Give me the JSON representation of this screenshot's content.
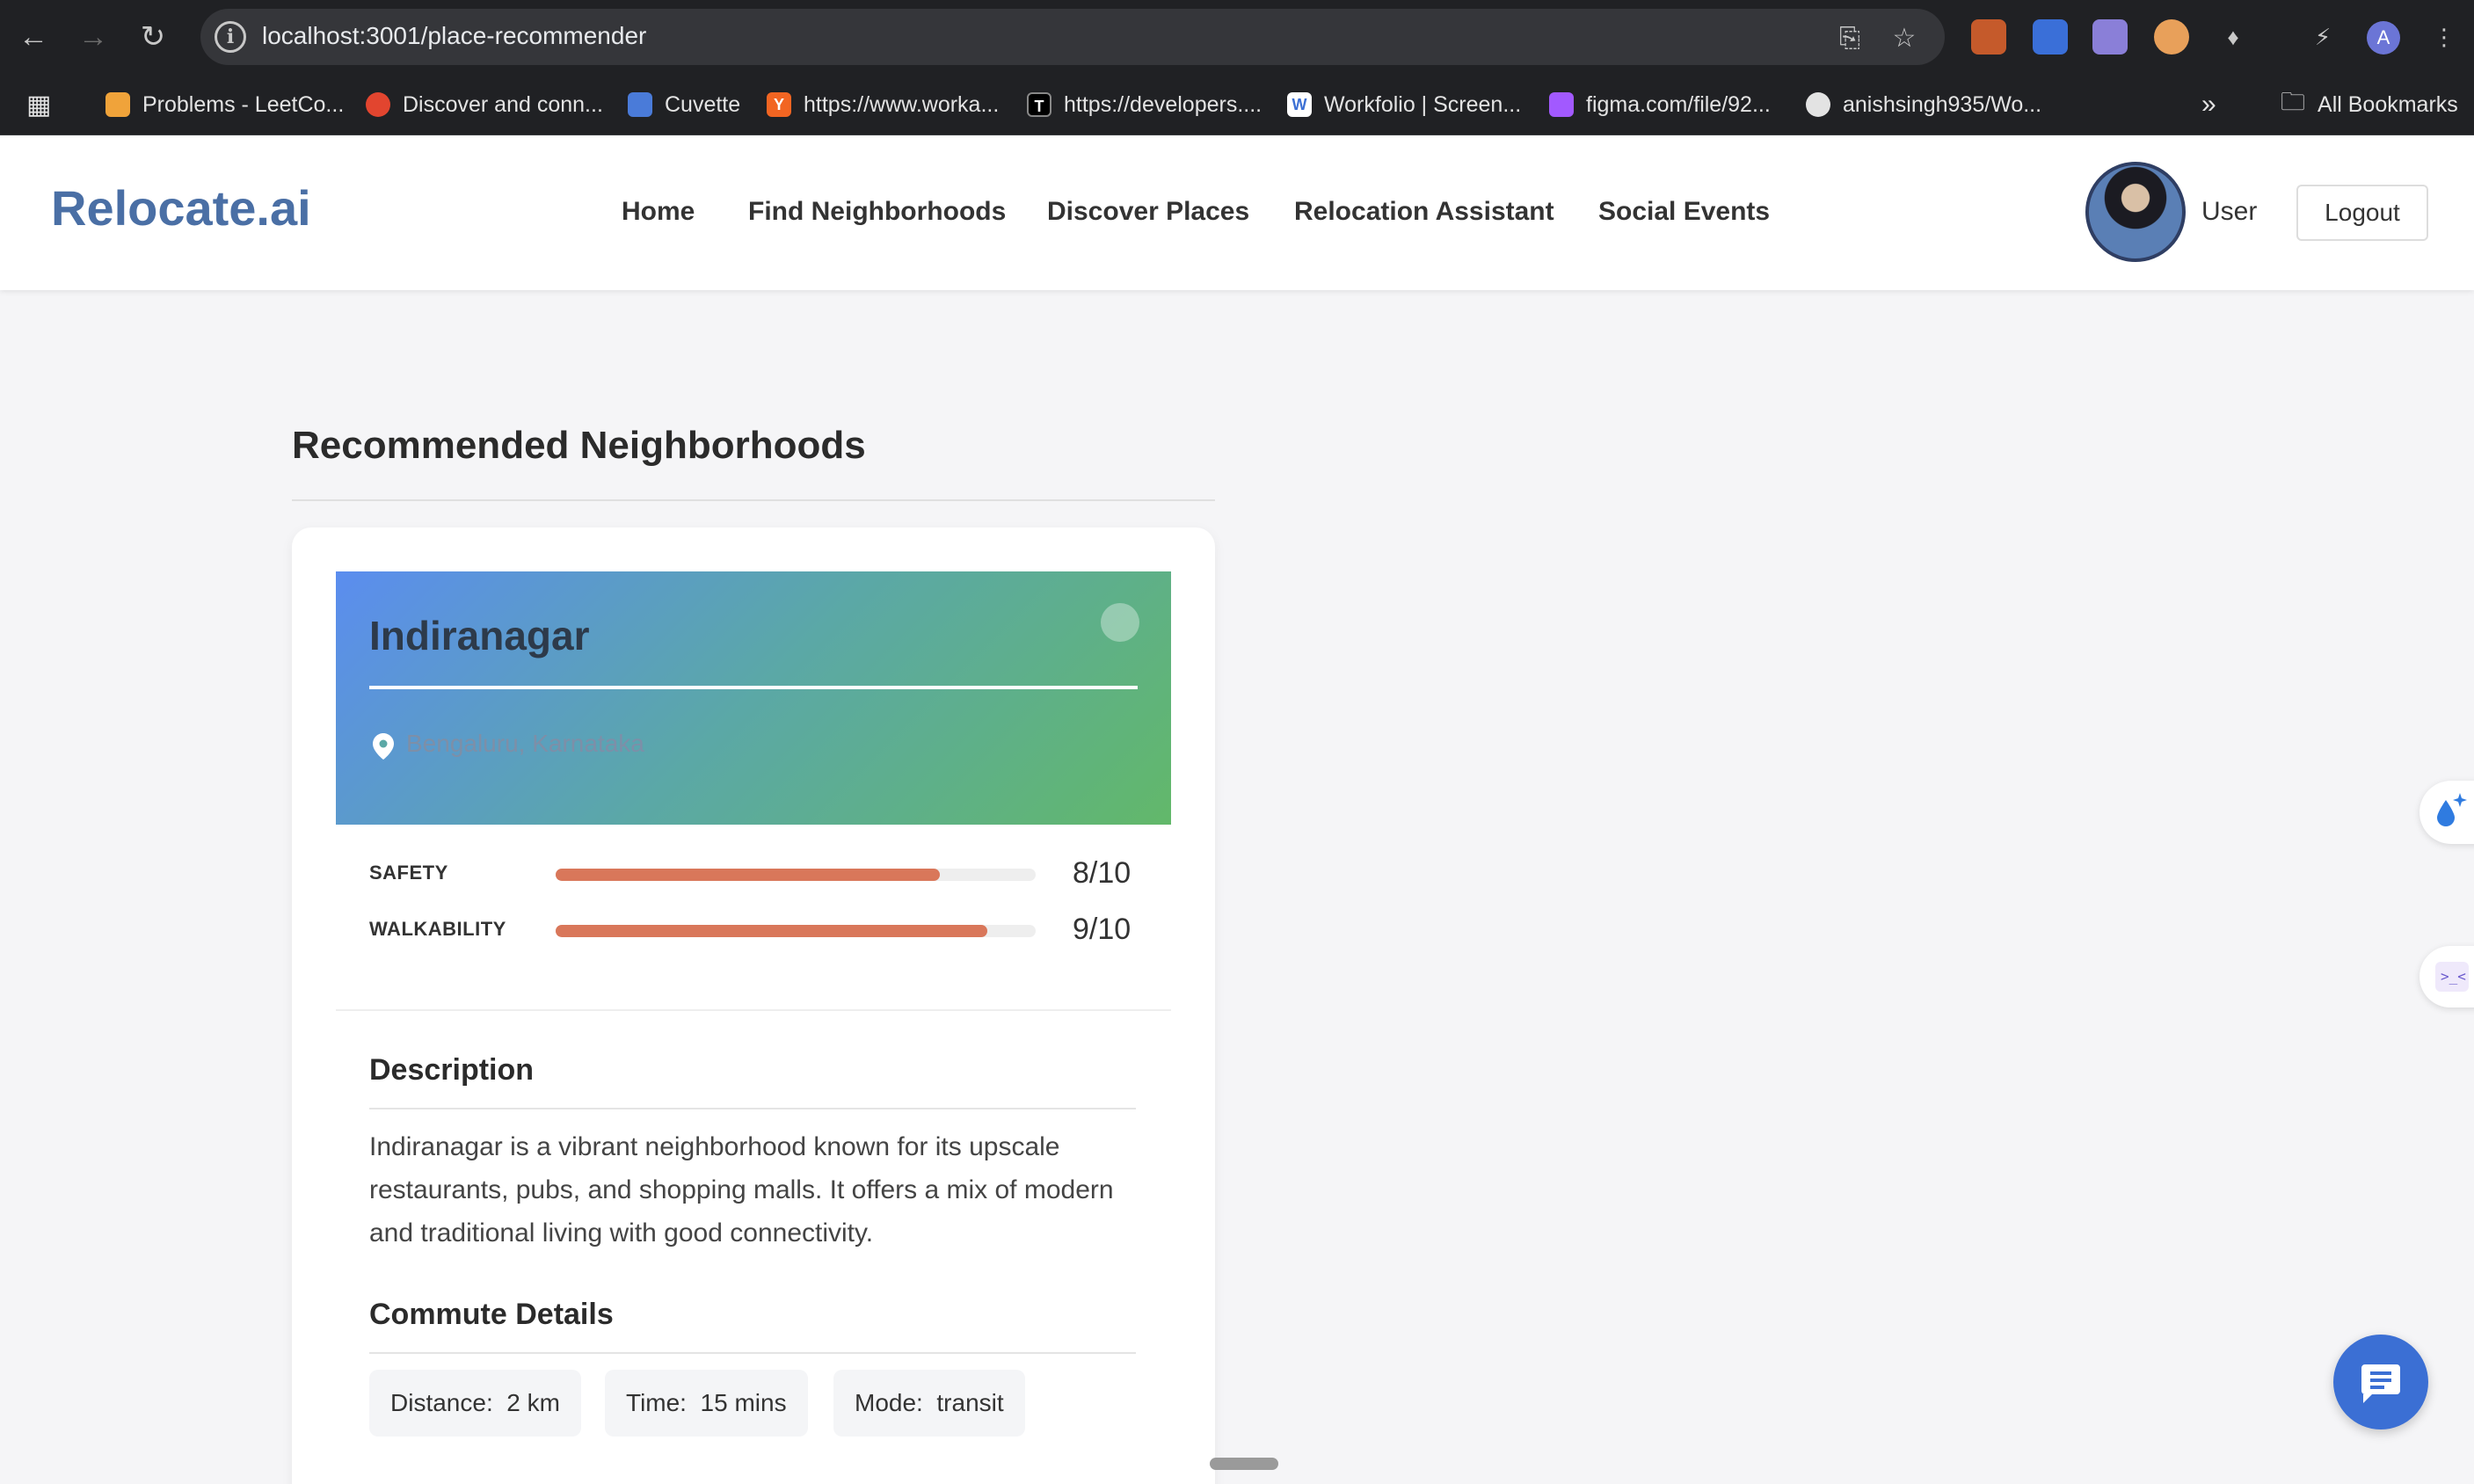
{
  "browser": {
    "url": "localhost:3001/place-recommender",
    "bookmarks": [
      {
        "label": "Problems - LeetCo...",
        "color": "#f0a33a"
      },
      {
        "label": "Discover and conn...",
        "color": "#e2452f"
      },
      {
        "label": "Cuvette",
        "color": "#4a7bd9"
      },
      {
        "label": "https://www.worka...",
        "color": "#f26522"
      },
      {
        "label": "https://developers....",
        "color": "#000000"
      },
      {
        "label": "Workfolio | Screen...",
        "color": "#3b6fd4"
      },
      {
        "label": "figma.com/file/92...",
        "color": "#a259ff"
      },
      {
        "label": "anishsingh935/Wo...",
        "color": "#e3e3e3"
      }
    ],
    "all_bookmarks": "All Bookmarks",
    "profile_initial": "A"
  },
  "header": {
    "logo": "Relocate.ai",
    "nav": [
      "Home",
      "Find Neighborhoods",
      "Discover Places",
      "Relocation Assistant",
      "Social Events"
    ],
    "user_label": "User",
    "logout_label": "Logout"
  },
  "main": {
    "section_title": "Recommended Neighborhoods",
    "card": {
      "name": "Indiranagar",
      "location": "Bengaluru, Karnataka",
      "metrics": [
        {
          "label": "SAFETY",
          "score_text": "8/10",
          "value": 8,
          "max": 10
        },
        {
          "label": "WALKABILITY",
          "score_text": "9/10",
          "value": 9,
          "max": 10
        }
      ],
      "description_title": "Description",
      "description": "Indiranagar is a vibrant neighborhood known for its upscale restaurants, pubs, and shopping malls. It offers a mix of modern and traditional living with good connectivity.",
      "commute_title": "Commute Details",
      "commute": {
        "distance_label": "Distance:",
        "distance": "2 km",
        "time_label": "Time:",
        "time": "15 mins",
        "mode_label": "Mode:",
        "mode": "transit"
      }
    }
  },
  "colors": {
    "accent": "#4a6fa5",
    "bar_fill": "#d9775a",
    "chat_fab": "#3b6fd4"
  }
}
